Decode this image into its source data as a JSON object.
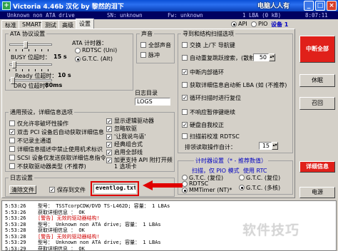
{
  "window": {
    "title": "Victoria 4.46b 汉化 by 黎然的泪下",
    "watermark": "电脑人人有",
    "buttons": {
      "minimize": "_",
      "maximize": "□",
      "close": "×"
    }
  },
  "info_bar": {
    "drive": "Unknown non ATA drive",
    "sn": "SN: unknown",
    "fw": "Fw: unknown",
    "size": "1 LBA (0 kB)",
    "clock": "8:07:11"
  },
  "tabs": [
    "标准",
    "SMART",
    "测试",
    "高级",
    "设置"
  ],
  "active_tab": "设置",
  "mode": {
    "api": "API",
    "pio": "PIO",
    "device_label": "设备 1"
  },
  "ata_timeouts": {
    "title": "ATA 协议设置",
    "busy_label": "BUSY 位超时：",
    "busy_value": "15 s",
    "ready_label": "Ready 位超时：",
    "ready_value": "10 s",
    "drq_label": "DRQ 位超时：",
    "drq_value": "80ms"
  },
  "ata_timer": {
    "title": "ATA 计时器：",
    "options": [
      "RDTSC (Uni)",
      "G.T.C. (Alt)"
    ],
    "selected": "G.T.C. (Alt)"
  },
  "sound": {
    "title": "声音",
    "all_sound": "全部声音",
    "beep": "脉冲"
  },
  "log_dir": {
    "title": "日志目录",
    "value": "LOGS"
  },
  "search": {
    "title": "寻到和结构扫描选项",
    "items": [
      {
        "label": "交换 上/下 导航键",
        "checked": false
      },
      {
        "label": "自动重复跳跃搜索，(散射)：",
        "checked": false
      },
      {
        "label": "中断内部循环",
        "checked": true
      },
      {
        "label": "获取详细信息启动新 LBA (如 (不推荐)",
        "checked": false
      },
      {
        "label": "循环扫描时进行复位",
        "checked": true
      },
      {
        "label": "不响应暂停键继续",
        "checked": false
      },
      {
        "label": "硬盘自我校正",
        "checked": true
      },
      {
        "label": "扫描前校准 RDTSC",
        "checked": false
      }
    ],
    "jump_value": "50",
    "sort_label": "排领读取操作自计：",
    "sort_value": "15"
  },
  "general": {
    "title": "通用预设，详细信息选项",
    "left": [
      {
        "label": "仅允许非破坏性操作",
        "checked": false
      },
      {
        "label": "双击 PCI 设备后自动获取详细信息",
        "checked": true
      },
      {
        "label": "不记录主通道",
        "checked": false
      },
      {
        "label": "详细信息描述中禁止使用机术标识",
        "checked": false
      },
      {
        "label": "SCSI 设备仅发送获取详细信息指令",
        "checked": false
      },
      {
        "label": "不获取驱动器类型 (不推荐)",
        "checked": false
      }
    ],
    "right": [
      {
        "label": "显示逻辑驱动器",
        "checked": true
      },
      {
        "label": "忽略软驱",
        "checked": true
      },
      {
        "label": "'让我说鸟语'",
        "checked": true
      },
      {
        "label": "经典组合式",
        "checked": true
      },
      {
        "label": "启用全部线",
        "checked": true
      },
      {
        "label": "加更支持 API 附打开频 1 选项卡",
        "checked": true
      }
    ]
  },
  "log_settings": {
    "title": "日志设置",
    "clear_button": "清除文件",
    "save_label": "保存到文件",
    "save_checked": true,
    "filename": "eventlog.txt"
  },
  "timer_settings": {
    "title": "计时器设置（* - 推荐数值）",
    "scan_pio_title": "扫描，仅 PIO 模式",
    "rtc_title": "使用 RTC",
    "left": [
      {
        "label": "G.T.C. (复位)",
        "selected": false
      },
      {
        "label": "RDTSC",
        "selected": false
      },
      {
        "label": "MMTimer (NT)*",
        "selected": true
      }
    ],
    "right": [
      {
        "label": "G.T.C. (复位)",
        "selected": false
      },
      {
        "label": "G.T.C. (多核)",
        "selected": true
      }
    ]
  },
  "side_buttons": [
    {
      "label": "中断全部",
      "style": "red"
    },
    {
      "label": "休眠",
      "style": "normal"
    },
    {
      "label": "召回",
      "style": "normal"
    },
    {
      "label": "详细信息",
      "style": "red"
    },
    {
      "label": "电源",
      "style": "normal"
    }
  ],
  "log": [
    {
      "time": "5:53:26",
      "msg": "型号：    TSSTcorpCDW/DVD TS-L462D;     容量：  1 LBAs",
      "err": false
    },
    {
      "time": "5:53:26",
      "msg": "获取详细信息 ：  OK",
      "err": false
    },
    {
      "time": "5:53:26",
      "msg": "[警告] 无效的驱动器结构!",
      "err": true
    },
    {
      "time": "5:53:28",
      "msg": "型号：    Unknown non ATA drive;      容量：  1 LBAs",
      "err": false
    },
    {
      "time": "5:53:28",
      "msg": "获取详细信息 ：  OK",
      "err": false
    },
    {
      "time": "5:53:28",
      "msg": "[警告] 无效的驱动器结构!",
      "err": true
    },
    {
      "time": "5:53:29",
      "msg": "型号：    Unknown non ATA drive;      容量：  1 LBAs",
      "err": false
    },
    {
      "time": "5:53:29",
      "msg": "获取详细信息 ：  OK",
      "err": false
    }
  ],
  "watermark_bottom": "软件技巧"
}
